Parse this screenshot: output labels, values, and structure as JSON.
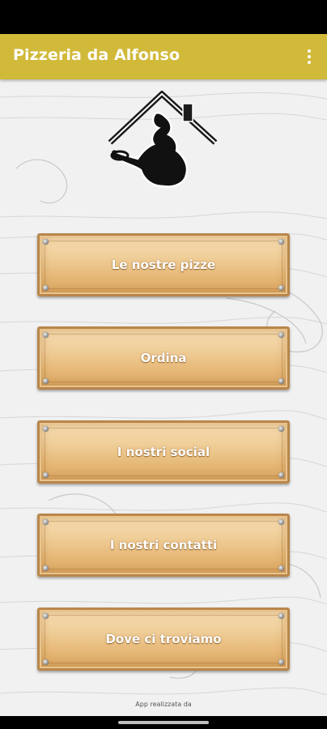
{
  "app_bar": {
    "title": "Pizzeria da Alfonso",
    "menu_icon": "more-vert-icon",
    "color": "#d1b93a"
  },
  "logo": {
    "icon": "pizzeria-logo-icon"
  },
  "menu": {
    "buttons": [
      {
        "label": "Le nostre pizze"
      },
      {
        "label": "Ordina"
      },
      {
        "label": "I nostri social"
      },
      {
        "label": "I nostri contatti"
      },
      {
        "label": "Dove ci troviamo"
      }
    ]
  },
  "footer": {
    "credit": "App realizzata da"
  }
}
